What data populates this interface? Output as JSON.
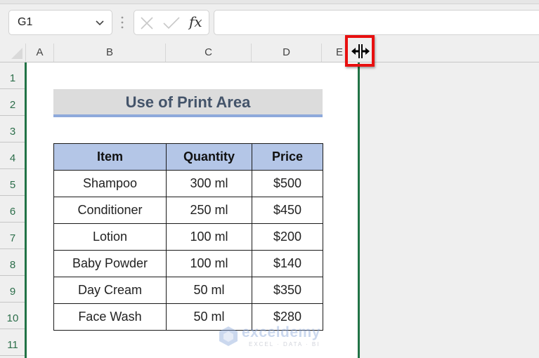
{
  "formula_bar": {
    "name_box_value": "G1",
    "formula_value": "",
    "icons": {
      "cancel": "x-icon",
      "enter": "check-icon",
      "function": "fx-icon"
    },
    "fx_label": "fx"
  },
  "columns": [
    "A",
    "B",
    "C",
    "D",
    "E"
  ],
  "rows": [
    "1",
    "2",
    "3",
    "4",
    "5",
    "6",
    "7",
    "8",
    "9",
    "10",
    "11"
  ],
  "sheet": {
    "title": "Use of Print Area",
    "table": {
      "headers": [
        "Item",
        "Quantity",
        "Price"
      ],
      "rows": [
        [
          "Shampoo",
          "300 ml",
          "$500"
        ],
        [
          "Conditioner",
          "250 ml",
          "$450"
        ],
        [
          "Lotion",
          "100 ml",
          "$200"
        ],
        [
          "Baby Powder",
          "100 ml",
          "$140"
        ],
        [
          "Day Cream",
          "50 ml",
          "$350"
        ],
        [
          "Face Wash",
          "50 ml",
          "$280"
        ]
      ]
    }
  },
  "cursor": {
    "type": "column-resize-icon",
    "highlight_color": "#e81010"
  },
  "colors": {
    "print_area_border": "#217346",
    "header_fill": "#b4c6e7",
    "title_fill": "#dcdcdc",
    "title_underline": "#8ea9db",
    "title_text": "#44546a"
  },
  "watermark": {
    "name": "exceldemy",
    "tagline": "EXCEL · DATA · BI"
  }
}
